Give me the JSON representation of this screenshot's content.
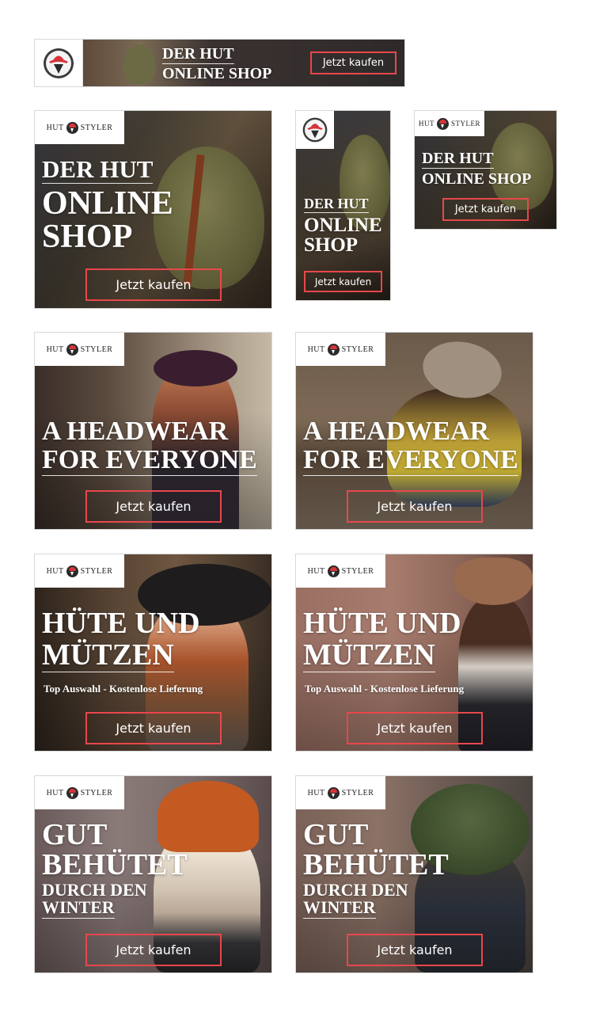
{
  "brand": {
    "word1": "HUT",
    "word2": "STYLER"
  },
  "cta_label": "Jetzt kaufen",
  "colors": {
    "cta_border": "#e8474c",
    "logo_red": "#d7353b"
  },
  "leaderboard": {
    "line1": "DER HUT",
    "line2": "ONLINE SHOP"
  },
  "shop": {
    "line1": "DER HUT",
    "line2": "ONLINE",
    "line3": "SHOP",
    "line_compact": "ONLINE SHOP"
  },
  "headwear": {
    "line1": "A HEADWEAR",
    "line2": "FOR EVERYONE"
  },
  "hute": {
    "line1": "HÜTE UND",
    "line2": "MÜTZEN",
    "sub1": "Top Auswahl",
    "sep": "-",
    "sub2": "Kostenlose Lieferung"
  },
  "winter": {
    "line1": "GUT",
    "line2": "BEHÜTET",
    "line3": "DURCH DEN",
    "line4": "WINTER"
  }
}
